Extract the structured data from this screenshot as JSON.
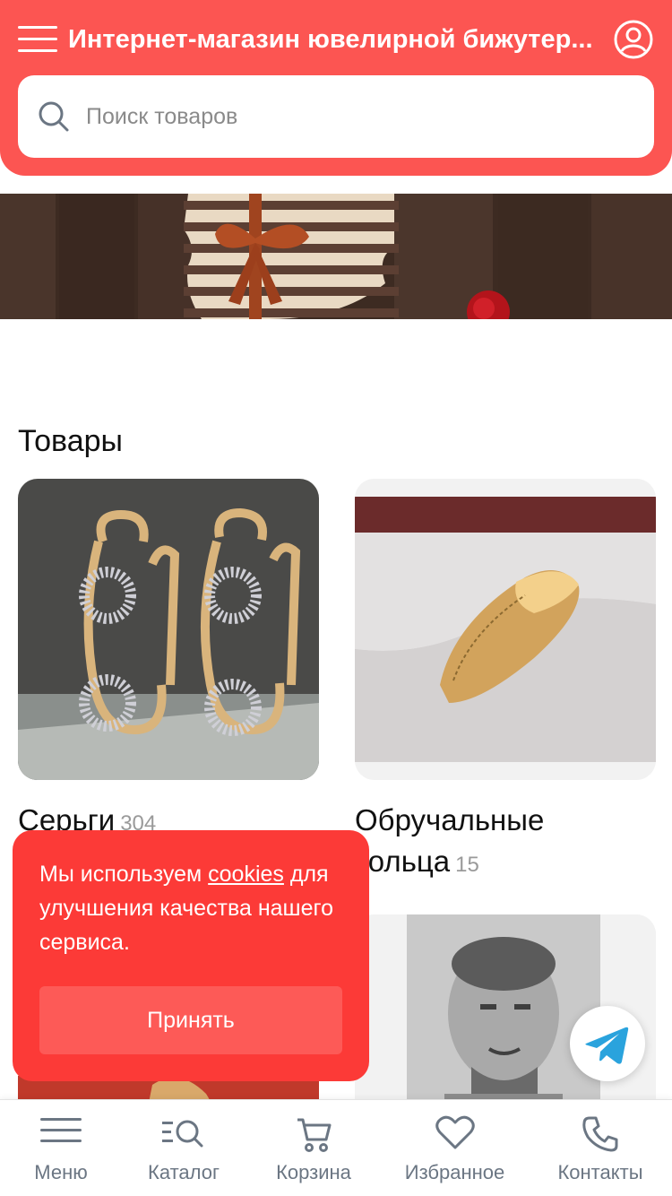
{
  "header": {
    "title": "Интернет-магазин ювелирной бижутер...",
    "menu_icon": "hamburger-icon",
    "profile_icon": "user-circle-icon",
    "accent": "#fc5552"
  },
  "search": {
    "placeholder": "Поиск товаров",
    "icon": "search-icon"
  },
  "section": {
    "title": "Товары"
  },
  "products": [
    {
      "name": "Серьги",
      "count": "304"
    },
    {
      "name": "Обручальные кольца",
      "count": "15"
    }
  ],
  "cookie": {
    "text_before": "Мы используем ",
    "link": "cookies",
    "text_after": " для улучшения качества нашего сервиса.",
    "accept_label": "Принять",
    "color": "#fc3a37"
  },
  "bottom_nav": [
    {
      "label": "Меню",
      "icon": "menu-icon"
    },
    {
      "label": "Каталог",
      "icon": "catalog-search-icon"
    },
    {
      "label": "Корзина",
      "icon": "cart-icon"
    },
    {
      "label": "Избранное",
      "icon": "heart-icon"
    },
    {
      "label": "Контакты",
      "icon": "phone-icon"
    }
  ],
  "floating": {
    "icon": "telegram-icon",
    "color": "#2aa3dd"
  }
}
